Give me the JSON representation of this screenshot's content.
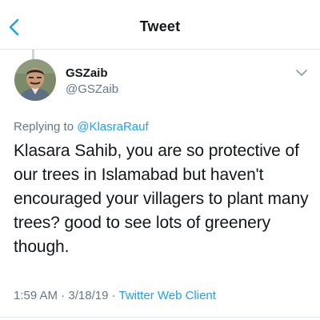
{
  "nav": {
    "title": "Tweet",
    "back_icon": "chevron-left-icon"
  },
  "author": {
    "display_name": "GSZaib",
    "handle": "@GSZaib",
    "menu_icon": "chevron-down-icon"
  },
  "reply": {
    "prefix": "Replying to",
    "mention": "@KlasraRauf"
  },
  "tweet": {
    "text": "Klasara Sahib, you are so protective of our trees in Islamabad but haven't encouraged your villagers to plant many trees? good to see lots of greenery though."
  },
  "meta": {
    "time": "1:59 AM",
    "date": "3/18/19",
    "separator": "·",
    "client": "Twitter Web Client"
  },
  "colors": {
    "accent": "#1da1f2",
    "text": "#14171a",
    "secondary": "#657786",
    "divider": "#e1e8ed"
  }
}
